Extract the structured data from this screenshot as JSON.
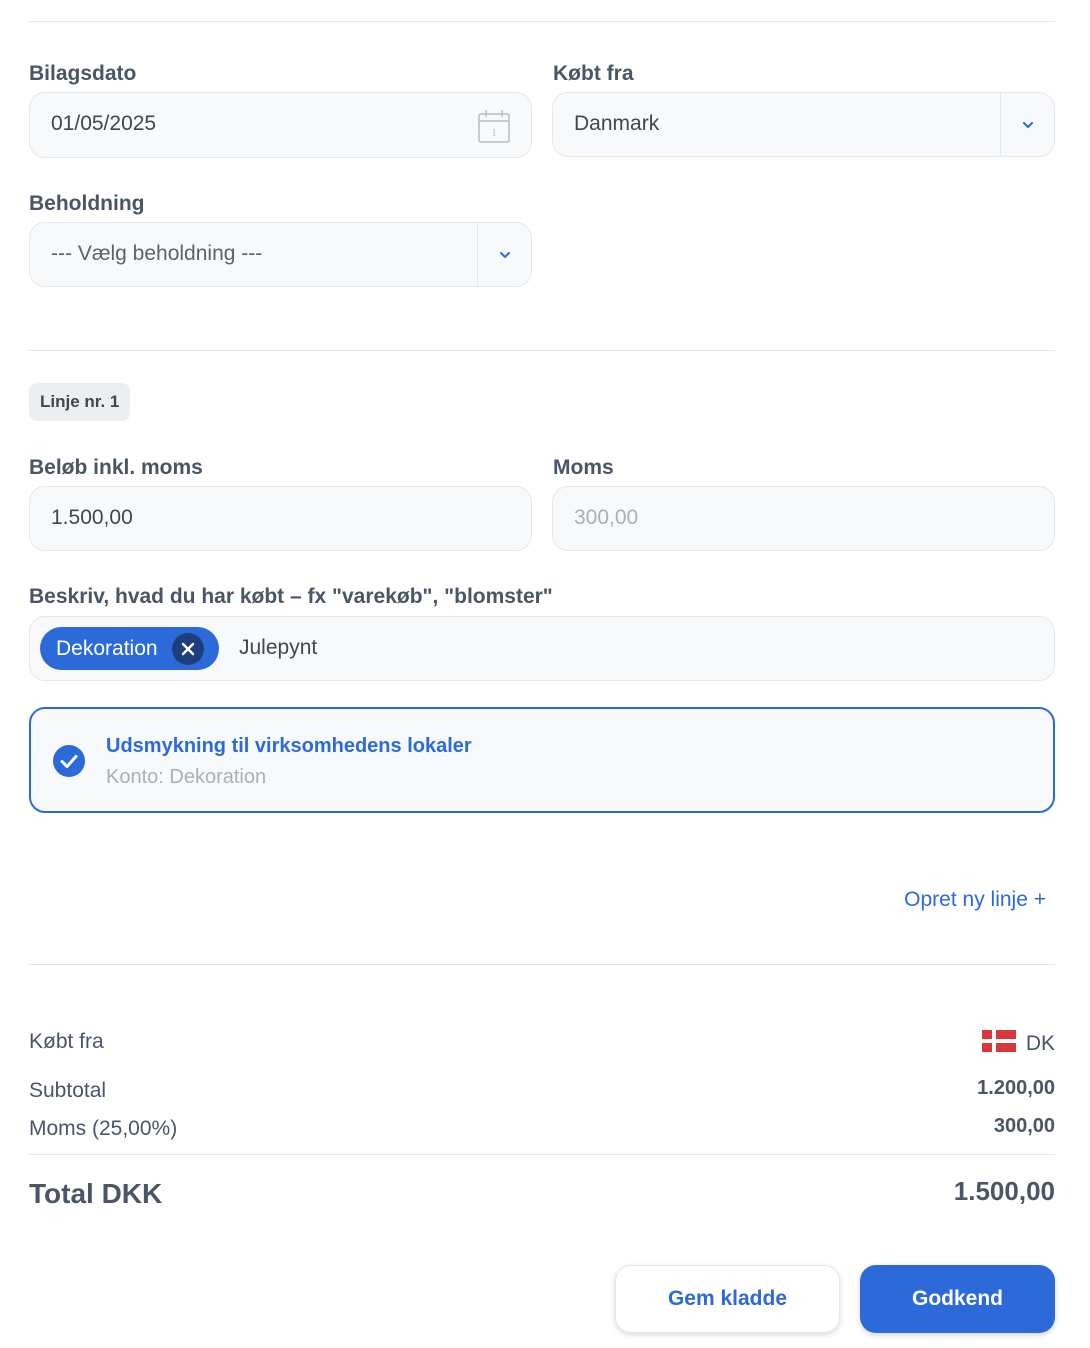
{
  "header": {
    "date_label": "Bilagsdato",
    "date_value": "01/05/2025",
    "bought_from_label": "Købt fra",
    "bought_from_value": "Danmark",
    "holding_label": "Beholdning",
    "holding_placeholder": "--- Vælg beholdning ---"
  },
  "line": {
    "badge": "Linje nr. 1",
    "amount_label": "Beløb inkl. moms",
    "amount_value": "1.500,00",
    "vat_label": "Moms",
    "vat_value": "300,00",
    "description_label": "Beskriv, hvad du har købt – fx \"varekøb\", \"blomster\"",
    "chip_label": "Dekoration",
    "description_text": "Julepynt",
    "suggestion_title": "Udsmykning til virksomhedens lokaler",
    "suggestion_subtitle": "Konto: Dekoration",
    "new_line_link": "Opret ny linje +"
  },
  "summary": {
    "bought_from_label": "Købt fra",
    "country_code": "DK",
    "subtotal_label": "Subtotal",
    "subtotal_value": "1.200,00",
    "vat_label": "Moms (25,00%)",
    "vat_value": "300,00",
    "total_label": "Total DKK",
    "total_value": "1.500,00"
  },
  "actions": {
    "save_draft": "Gem kladde",
    "approve": "Godkend"
  },
  "colors": {
    "accent": "#2c6ad9",
    "flag_red": "#d9373c"
  }
}
